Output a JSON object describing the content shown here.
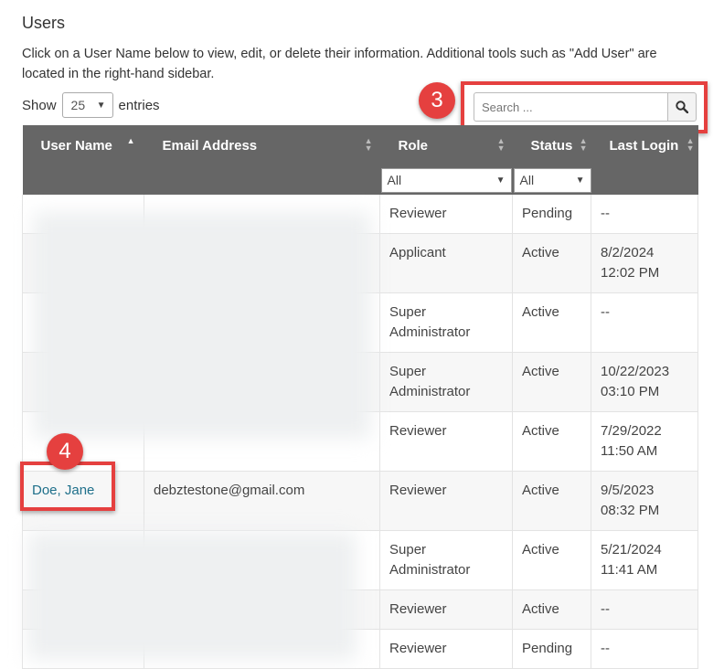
{
  "page": {
    "title": "Users",
    "intro": "Click on a User Name below to view, edit, or delete their information. Additional tools such as \"Add User\" are located in the right-hand sidebar."
  },
  "length_menu": {
    "prefix": "Show",
    "value": "25",
    "suffix": "entries"
  },
  "search": {
    "placeholder": "Search ..."
  },
  "callouts": {
    "search": "3",
    "user": "4"
  },
  "table": {
    "columns": [
      "User Name",
      "Email Address",
      "Role",
      "Status",
      "Last Login"
    ],
    "filters": {
      "role": "All",
      "status": "All"
    },
    "rows": [
      {
        "user": "",
        "email": "",
        "role": "Reviewer",
        "status": "Pending",
        "login": "--"
      },
      {
        "user": "",
        "email": "",
        "role": "Applicant",
        "status": "Active",
        "login": "8/2/2024\n12:02 PM"
      },
      {
        "user": "",
        "email": "",
        "role": "Super\nAdministrator",
        "status": "Active",
        "login": "--"
      },
      {
        "user": "",
        "email": "",
        "role": "Super\nAdministrator",
        "status": "Active",
        "login": "10/22/2023\n03:10 PM"
      },
      {
        "user": "",
        "email": "",
        "role": "Reviewer",
        "status": "Active",
        "login": "7/29/2022\n11:50 AM"
      },
      {
        "user": "Doe, Jane",
        "email": "debztestone@gmail.com",
        "role": "Reviewer",
        "status": "Active",
        "login": "9/5/2023\n08:32 PM"
      },
      {
        "user": "",
        "email": "",
        "role": "Super\nAdministrator",
        "status": "Active",
        "login": "5/21/2024\n11:41 AM"
      },
      {
        "user": "",
        "email": "",
        "role": "Reviewer",
        "status": "Active",
        "login": "--"
      },
      {
        "user": "",
        "email": "",
        "role": "Reviewer",
        "status": "Pending",
        "login": "--"
      }
    ]
  },
  "colors": {
    "header_bg": "#666666",
    "callout": "#e5403f",
    "link": "#1e6f8a"
  }
}
